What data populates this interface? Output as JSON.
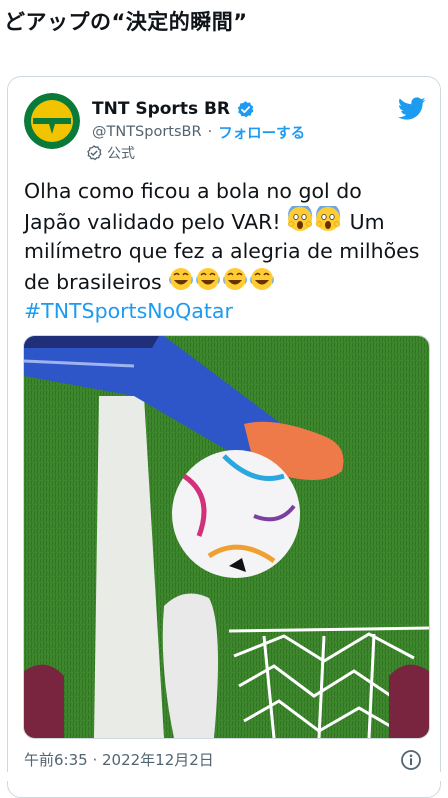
{
  "article": {
    "headline": "どアップの“決定的瞬間”"
  },
  "tweet": {
    "display_name": "TNT Sports BR",
    "handle": "@TNTSportsBR",
    "separator": "·",
    "follow_label": "フォローする",
    "official_label": "公式",
    "text_lines": [
      "Olha como ficou a bola no gol do",
      "Japão validado pelo VAR!",
      "Um",
      "milímetro que fez a alegria de milhões",
      "de brasileiros"
    ],
    "hashtag": "#TNTSportsNoQatar",
    "timestamp": "午前6:35 · 2022年12月2日",
    "icons": {
      "avatar": "tnt-sports-logo",
      "verified": "verified-badge-icon",
      "official": "official-check-icon",
      "brand": "twitter-bird-icon",
      "scream": "face-screaming-emoji",
      "laugh": "face-with-tears-of-joy-emoji",
      "info": "info-icon"
    },
    "colors": {
      "accent": "#1d9bf0",
      "text": "#0f1419",
      "muted": "#536471",
      "avatar_green": "#0a7a3b",
      "avatar_yellow": "#f2c400"
    }
  }
}
